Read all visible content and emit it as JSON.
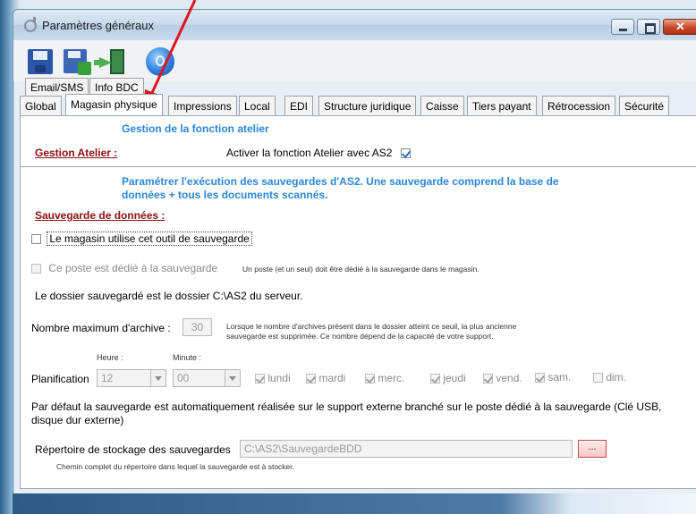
{
  "window": {
    "title": "Paramètres généraux"
  },
  "toolbar": {
    "buttons": [
      {
        "name": "save-icon"
      },
      {
        "name": "save-all-icon"
      },
      {
        "name": "exit-icon"
      },
      {
        "name": "help-icon"
      }
    ]
  },
  "tabs": {
    "row1": [
      "Email/SMS",
      "Info BDC"
    ],
    "row2": [
      "Global",
      "Magasin physique",
      "Impressions",
      "Local",
      "EDI",
      "Structure juridique",
      "Caisse",
      "Tiers payant",
      "Rétrocession",
      "Sécurité"
    ],
    "active": "Magasin physique"
  },
  "atelier": {
    "header": "Gestion de la fonction atelier",
    "section_label": "Gestion Atelier :",
    "checkbox_label": "Activer la fonction Atelier avec AS2",
    "checked": true
  },
  "backup": {
    "header_line1": "Paramétrer l'exécution des sauvegardes d'AS2. Une sauvegarde comprend la base de",
    "header_line2": "données + tous les documents scannés.",
    "section_label": "Sauvegarde de données :",
    "uses_tool_label": "Le magasin utilise cet outil de sauvegarde",
    "uses_tool_checked": false,
    "dedicated_label": "Ce poste est dédié à la sauvegarde",
    "dedicated_note": "Un poste (et un seul) doit être dédié à la sauvegarde dans le magasin.",
    "folder_text": "Le dossier sauvegardé est le dossier C:\\AS2 du serveur.",
    "max_archive_label": "Nombre maximum d'archive :",
    "max_archive_value": "30",
    "max_archive_note1": "Lorsque le nombre d'archives présent dans le dossier atteint ce seuil, la plus ancienne",
    "max_archive_note2": "sauvegarde est supprimée. Ce nombre dépend de la capacité de votre support.",
    "hour_label": "Heure :",
    "minute_label": "Minute :",
    "planning_label": "Planification",
    "hour_value": "12",
    "minute_value": "00",
    "days": [
      {
        "label": "lundi",
        "checked": true
      },
      {
        "label": "mardi",
        "checked": true
      },
      {
        "label": "merc.",
        "checked": true
      },
      {
        "label": "jeudi",
        "checked": true
      },
      {
        "label": "vend.",
        "checked": true
      },
      {
        "label": "sam.",
        "checked": true
      },
      {
        "label": "dim.",
        "checked": false
      }
    ],
    "default_text_line1": "Par défaut la sauvegarde est automatiquement réalisée sur le support externe branché sur le poste dédié à la sauvegarde (Clé USB,",
    "default_text_line2": "disque dur externe)",
    "storage_label": "Répertoire de stockage des sauvegardes",
    "storage_value": "C:\\AS2\\SauvegardeBDD",
    "browse_label": "...",
    "storage_note": "Chemin complet du répertoire dans lequel la sauvegarde est à stocker."
  },
  "colors": {
    "accent_blue": "#2c86d6",
    "section_red": "#8b1010",
    "annotation_arrow": "#e0141c"
  }
}
